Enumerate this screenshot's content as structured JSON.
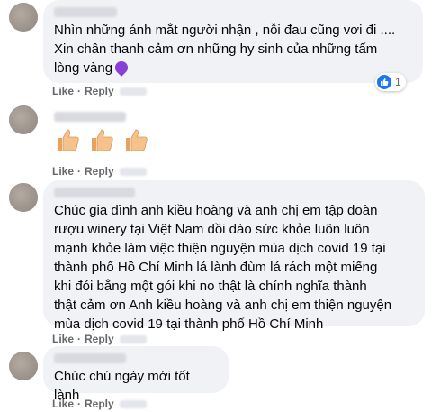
{
  "comments": [
    {
      "text": "Nhìn những ánh mắt người nhận , nỗi đau cũng vơi đi ....\nXin chân thanh cảm ơn những hy sinh của những tấm\nlòng vàng",
      "emoji": "purple-heart-emoji",
      "reaction_count": "1"
    },
    {
      "emoji": "three-thumbs-up"
    },
    {
      "text": "Chúc gia đình anh kiều hoàng và anh chị em tập đoàn\nrượu winery tại Việt Nam dồi dào sức khỏe luôn luôn\nmạnh khỏe làm việc thiện nguyện mùa dịch covid 19 tại\nthành phố Hồ Chí Minh lá lành đùm lá rách một miếng\nkhi đói bằng một gói khi no thật là chính nghĩa thành\nthật cảm ơn Anh kiều hoàng và anh chị em thiện nguyện\nmùa dịch covid 19 tại thành phố Hồ Chí Minh"
    },
    {
      "text": "Chúc chú ngày mới tốt lành"
    }
  ],
  "actions": {
    "like": "Like",
    "separator": "·",
    "reply": "Reply"
  },
  "colors": {
    "bubble": "#f0f2f5",
    "meta": "#65676b",
    "like_blue": "#1877f2",
    "heart": "#8b3fd9"
  }
}
